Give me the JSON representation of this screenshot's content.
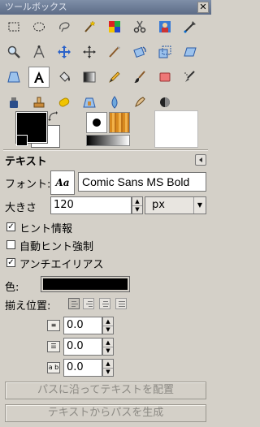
{
  "window": {
    "title": "ツールボックス",
    "close_glyph": "✕"
  },
  "tools": [
    {
      "icon": "rect-select-icon"
    },
    {
      "icon": "ellipse-select-icon"
    },
    {
      "icon": "free-select-icon"
    },
    {
      "icon": "fuzzy-select-icon"
    },
    {
      "icon": "color-select-icon"
    },
    {
      "icon": "scissors-select-icon"
    },
    {
      "icon": "foreground-select-icon"
    },
    {
      "icon": "paths-icon"
    },
    {
      "icon": "zoom-icon"
    },
    {
      "icon": "measure-icon"
    },
    {
      "icon": "move-icon"
    },
    {
      "icon": "align-icon"
    },
    {
      "icon": "crop-icon"
    },
    {
      "icon": "rotate-icon"
    },
    {
      "icon": "scale-icon"
    },
    {
      "icon": "shear-icon"
    },
    {
      "icon": "perspective-icon"
    },
    {
      "icon": "text-icon",
      "selected": true
    },
    {
      "icon": "bucket-fill-icon"
    },
    {
      "icon": "blend-icon"
    },
    {
      "icon": "pencil-icon"
    },
    {
      "icon": "paintbrush-icon"
    },
    {
      "icon": "eraser-icon"
    },
    {
      "icon": "airbrush-icon"
    },
    {
      "icon": "ink-icon"
    },
    {
      "icon": "clone-icon"
    },
    {
      "icon": "heal-icon"
    },
    {
      "icon": "perspective-clone-icon"
    },
    {
      "icon": "blur-icon"
    },
    {
      "icon": "smudge-icon"
    },
    {
      "icon": "dodge-burn-icon"
    }
  ],
  "options": {
    "title": "テキスト",
    "font_label": "フォント:",
    "font_preview": "Aa",
    "font_value": "Comic Sans MS Bold",
    "size_label": "大きさ",
    "size_value": "120",
    "unit_value": "px",
    "hinting_label": "ヒント情報",
    "hinting_checked": true,
    "autohint_label": "自動ヒント強制",
    "autohint_checked": false,
    "antialias_label": "アンチエイリアス",
    "antialias_checked": true,
    "color_label": "色:",
    "color_value": "#000000",
    "justify_label": "揃え位置:",
    "indent_value": "0.0",
    "line_spacing_value": "0.0",
    "letter_spacing_value": "0.0",
    "letter_spacing_icon_text": "a b",
    "path_from_text_along": "パスに沿ってテキストを配置",
    "path_from_text": "テキストからパスを生成"
  },
  "colors": {
    "foreground": "#000000",
    "background": "#ffffff",
    "panel": "#d4d0c8",
    "title_bar": "#6a7893"
  }
}
